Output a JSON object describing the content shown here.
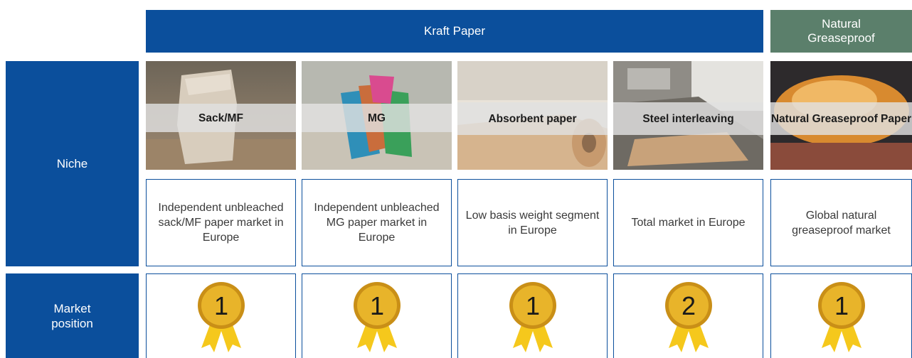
{
  "headers": {
    "kraft_paper": "Kraft Paper",
    "natural_greaseproof": "Natural\nGreaseproof"
  },
  "row_labels": {
    "niche": "Niche",
    "market_position": "Market\nposition"
  },
  "columns": [
    {
      "image_label": "Sack/MF",
      "description": "Independent unbleached sack/MF paper market in Europe",
      "rank": "1"
    },
    {
      "image_label": "MG",
      "description": "Independent unbleached MG paper market in Europe",
      "rank": "1"
    },
    {
      "image_label": "Absorbent paper",
      "description": "Low basis weight segment in Europe",
      "rank": "1"
    },
    {
      "image_label": "Steel interleaving",
      "description": "Total market in Europe",
      "rank": "2"
    },
    {
      "image_label": "Natural Greaseproof Paper",
      "description": "Global natural greaseproof market",
      "rank": "1"
    }
  ],
  "colors": {
    "primary_blue": "#0b4f9c",
    "greaseproof_green": "#5b7f6b",
    "medal_gold": "#e8b42a",
    "ribbon_yellow": "#f5c81c"
  },
  "icons": [
    "medal-icon"
  ]
}
